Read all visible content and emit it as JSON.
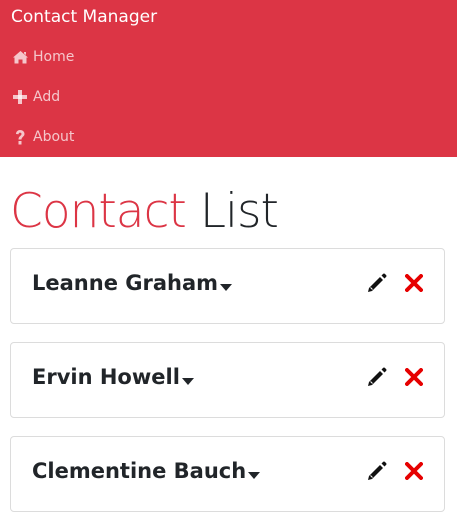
{
  "navbar": {
    "brand": "Contact Manager",
    "items": [
      {
        "label": "Home",
        "icon": "home-icon"
      },
      {
        "label": "Add",
        "icon": "plus-icon"
      },
      {
        "label": "About",
        "icon": "question-icon"
      }
    ]
  },
  "main": {
    "title_accent": "Contact",
    "title_rest": "List",
    "contacts": [
      {
        "name": "Leanne Graham"
      },
      {
        "name": "Ervin Howell"
      },
      {
        "name": "Clementine Bauch"
      }
    ],
    "actions": {
      "edit_icon": "pencil-icon",
      "delete_icon": "times-icon"
    }
  },
  "colors": {
    "brand": "#dc3545",
    "delete": "#e60000",
    "nav_text": "rgba(255,255,255,0.72)"
  }
}
